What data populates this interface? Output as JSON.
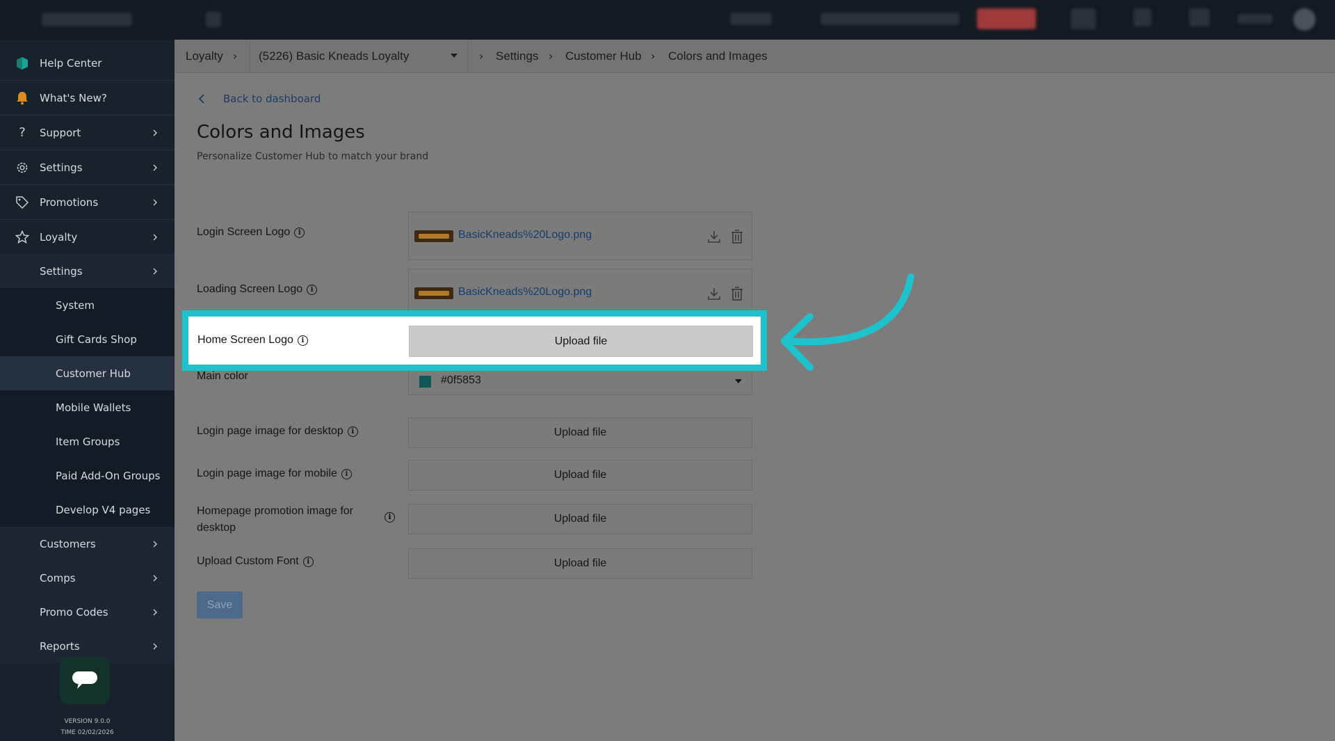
{
  "sidebar": {
    "items": [
      {
        "label": "Help Center",
        "icon": "help-center-icon"
      },
      {
        "label": "What's New?",
        "icon": "bell-icon"
      },
      {
        "label": "Support",
        "icon": "question-icon"
      },
      {
        "label": "Settings",
        "icon": "gear-icon"
      },
      {
        "label": "Promotions",
        "icon": "tag-icon"
      },
      {
        "label": "Loyalty",
        "icon": "star-icon"
      }
    ],
    "loyalty_sub": {
      "settings": "Settings"
    },
    "settings_sub": [
      "System",
      "Gift Cards Shop",
      "Customer Hub",
      "Mobile Wallets",
      "Item Groups",
      "Paid Add-On Groups",
      "Develop V4 pages"
    ],
    "more": [
      "Customers",
      "Comps",
      "Promo Codes",
      "Reports"
    ],
    "version": "VERSION 9.0.0",
    "time": "TIME 02/02/2026"
  },
  "breadcrumb": {
    "loyalty": "Loyalty",
    "program": "(5226) Basic Kneads Loyalty",
    "settings": "Settings",
    "hub": "Customer Hub",
    "page": "Colors and Images"
  },
  "page": {
    "back": "Back to dashboard",
    "title": "Colors and Images",
    "subtitle": "Personalize Customer Hub to match your brand"
  },
  "fields": {
    "login_logo": {
      "label": "Login Screen Logo",
      "file": "BasicKneads%20Logo.png"
    },
    "loading_logo": {
      "label": "Loading Screen Logo",
      "file": "BasicKneads%20Logo.png"
    },
    "home_logo": {
      "label": "Home Screen Logo",
      "button": "Upload file"
    },
    "main_color": {
      "label": "Main color",
      "value": "#0f5853"
    },
    "login_desktop": {
      "label": "Login page image for desktop",
      "button": "Upload file"
    },
    "login_mobile": {
      "label": "Login page image for mobile",
      "button": "Upload file"
    },
    "promo_desktop": {
      "label_line1": "Homepage promotion image for",
      "label_line2": "desktop",
      "button": "Upload file"
    },
    "custom_font": {
      "label": "Upload Custom Font",
      "button": "Upload file"
    }
  },
  "save": "Save",
  "colors": {
    "highlight": "#1ec2cc",
    "brand": "#0f5853",
    "sidebar": "#17222d"
  }
}
